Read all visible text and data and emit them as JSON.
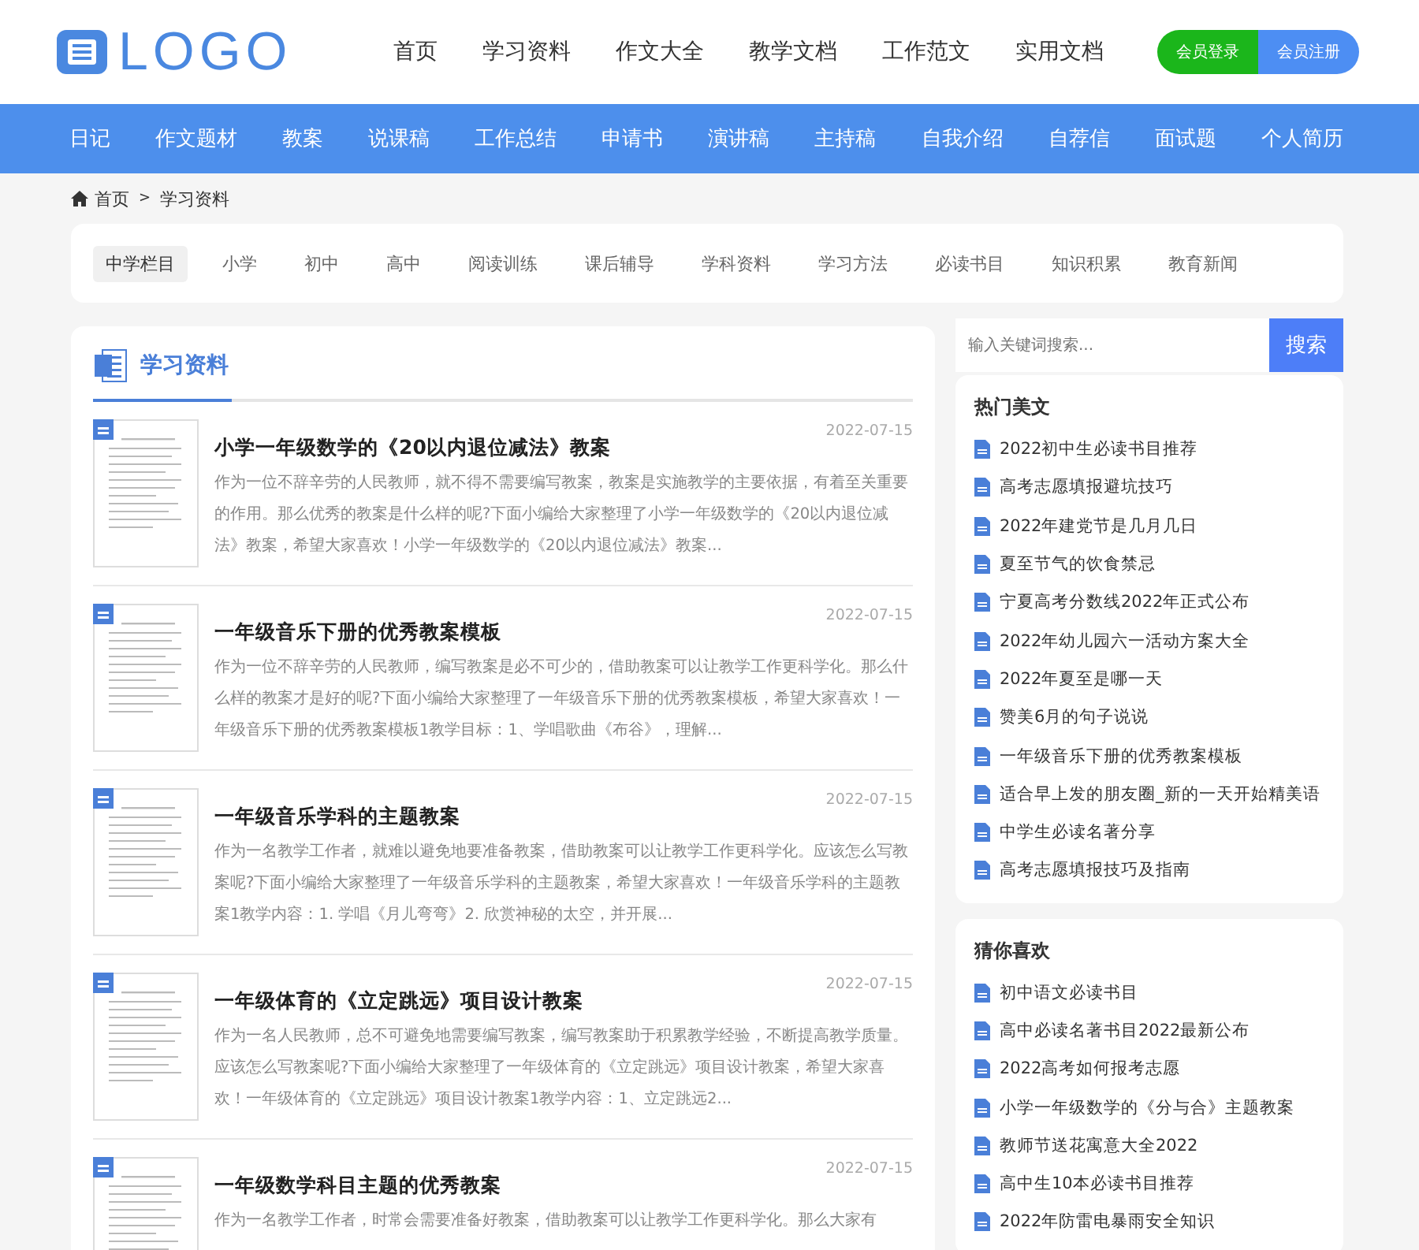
{
  "header": {
    "logo": "LOGO",
    "nav": [
      {
        "label": "首页"
      },
      {
        "label": "学习资料"
      },
      {
        "label": "作文大全"
      },
      {
        "label": "教学文档"
      },
      {
        "label": "工作范文"
      },
      {
        "label": "实用文档"
      }
    ],
    "login": "会员登录",
    "register": "会员注册"
  },
  "category_bar": [
    "日记",
    "作文题材",
    "教案",
    "说课稿",
    "工作总结",
    "申请书",
    "演讲稿",
    "主持稿",
    "自我介绍",
    "自荐信",
    "面试题",
    "个人简历"
  ],
  "breadcrumb": [
    "首页",
    "学习资料"
  ],
  "breadcrumb_separator": ">",
  "subnav": [
    {
      "label": "中学栏目",
      "selected": true
    },
    {
      "label": "小学",
      "selected": false
    },
    {
      "label": "初中",
      "selected": false
    },
    {
      "label": "高中",
      "selected": false
    },
    {
      "label": "阅读训练",
      "selected": false
    },
    {
      "label": "课后辅导",
      "selected": false
    },
    {
      "label": "学科资料",
      "selected": false
    },
    {
      "label": "学习方法",
      "selected": false
    },
    {
      "label": "必读书目",
      "selected": false
    },
    {
      "label": "知识积累",
      "selected": false
    },
    {
      "label": "教育新闻",
      "selected": false
    }
  ],
  "section_title": "学习资料",
  "articles": [
    {
      "title": "小学一年级数学的《20以内退位减法》教案",
      "date": "2022-07-15",
      "summary": "作为一位不辞辛劳的人民教师，就不得不需要编写教案，教案是实施教学的主要依据，有着至关重要的作用。那么优秀的教案是什么样的呢?下面小编给大家整理了小学一年级数学的《20以内退位减法》教案，希望大家喜欢！小学一年级数学的《20以内退位减法》教案..."
    },
    {
      "title": "一年级音乐下册的优秀教案模板",
      "date": "2022-07-15",
      "summary": "作为一位不辞辛劳的人民教师，编写教案是必不可少的，借助教案可以让教学工作更科学化。那么什么样的教案才是好的呢?下面小编给大家整理了一年级音乐下册的优秀教案模板，希望大家喜欢！一年级音乐下册的优秀教案模板1教学目标：1、学唱歌曲《布谷》，理解..."
    },
    {
      "title": "一年级音乐学科的主题教案",
      "date": "2022-07-15",
      "summary": "作为一名教学工作者，就难以避免地要准备教案，借助教案可以让教学工作更科学化。应该怎么写教案呢?下面小编给大家整理了一年级音乐学科的主题教案，希望大家喜欢！一年级音乐学科的主题教案1教学内容：1. 学唱《月儿弯弯》2. 欣赏神秘的太空，并开展..."
    },
    {
      "title": "一年级体育的《立定跳远》项目设计教案",
      "date": "2022-07-15",
      "summary": "作为一名人民教师，总不可避免地需要编写教案，编写教案助于积累教学经验，不断提高教学质量。应该怎么写教案呢?下面小编给大家整理了一年级体育的《立定跳远》项目设计教案，希望大家喜欢！一年级体育的《立定跳远》项目设计教案1教学内容：1、立定跳远2..."
    },
    {
      "title": "一年级数学科目主题的优秀教案",
      "date": "2022-07-15",
      "summary": "作为一名教学工作者，时常会需要准备好教案，借助教案可以让教学工作更科学化。那么大家有"
    }
  ],
  "search": {
    "placeholder": "输入关键词搜索...",
    "button": "搜索"
  },
  "widgets": [
    {
      "title": "热门美文",
      "items": [
        "2022初中生必读书目推荐",
        "高考志愿填报避坑技巧",
        "2022年建党节是几月几日",
        "夏至节气的饮食禁忌",
        "宁夏高考分数线2022年正式公布",
        "2022年幼儿园六一活动方案大全",
        "2022年夏至是哪一天",
        "赞美6月的句子说说",
        "一年级音乐下册的优秀教案模板",
        "适合早上发的朋友圈_新的一天开始精美语",
        "中学生必读名著分享",
        "高考志愿填报技巧及指南"
      ]
    },
    {
      "title": "猜你喜欢",
      "items": [
        "初中语文必读书目",
        "高中必读名著书目2022最新公布",
        "2022高考如何报考志愿",
        "小学一年级数学的《分与合》主题教案",
        "教师节送花寓意大全2022",
        "高中生10本必读书目推荐",
        "2022年防雷电暴雨安全知识"
      ]
    }
  ]
}
